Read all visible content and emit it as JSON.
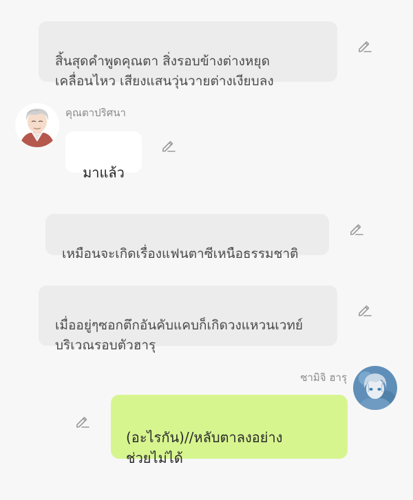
{
  "messages": {
    "narration_1": "สิ้นสุดคำพูดคุณตา สิ่งรอบข้างต่างหยุด\nเคลื่อนไหว เสียงแสนวุ่นวายต่างเงียบลง",
    "grandpa": {
      "name": "คุณตาปริศนา",
      "text": "มาแล้ว"
    },
    "narration_2": "เหมือนจะเกิดเรื่องแฟนตาซีเหนือธรรมชาติ",
    "narration_3": "เมื่ออยู่ๆซอกตึกอันคับแคบก็เกิดวงแหวนเวทย์\nบริเวณรอบตัวฮารุ",
    "haru": {
      "name": "ซามิจิ ฮารุ",
      "text": "(อะไรกัน)//หลับตาลงอย่าง\nช่วยไม่ได้"
    }
  },
  "icons": {
    "edit": "pencil-edit-icon"
  },
  "colors": {
    "background": "#f7f7f7",
    "narration_bubble": "#ececec",
    "incoming_bubble": "#ffffff",
    "outgoing_bubble": "#d7f58f"
  }
}
